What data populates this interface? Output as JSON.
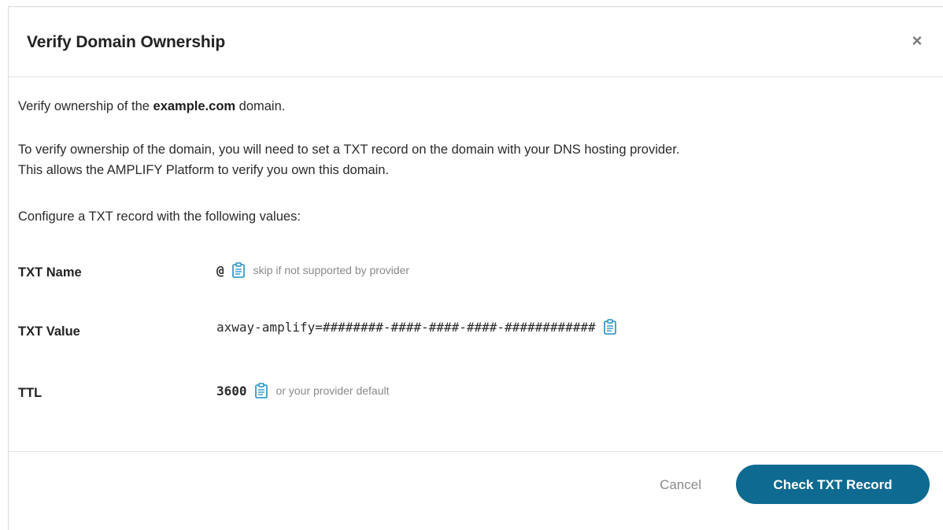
{
  "dialog": {
    "title": "Verify Domain Ownership",
    "close_label": "×"
  },
  "body": {
    "intro_prefix": "Verify ownership of the ",
    "domain": "example.com",
    "intro_suffix": " domain.",
    "explanation_line1": "To verify ownership of the domain, you will need to set a TXT record on the domain with your DNS hosting provider.",
    "explanation_line2": "This allows the AMPLIFY Platform to verify you own this domain.",
    "configure_text": "Configure a TXT record with the following values:"
  },
  "records": [
    {
      "label": "TXT Name",
      "value": "@",
      "hint": "skip if not supported by provider"
    },
    {
      "label": "TXT Value",
      "value": "axway-amplify=########-####-####-####-############",
      "hint": ""
    },
    {
      "label": "TTL",
      "value": "3600",
      "hint": "or your provider default"
    }
  ],
  "footer": {
    "cancel_label": "Cancel",
    "primary_label": "Check TXT Record"
  },
  "colors": {
    "primary": "#0f6a92",
    "icon": "#1f8fc4",
    "muted": "#8a8a8a"
  },
  "icons": {
    "copy": "clipboard-icon",
    "close": "close-icon"
  }
}
